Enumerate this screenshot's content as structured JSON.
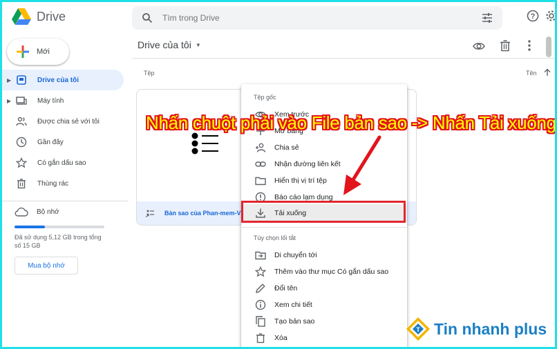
{
  "app": {
    "name": "Drive"
  },
  "search": {
    "placeholder": "Tìm trong Drive"
  },
  "sidebar": {
    "new_label": "Mới",
    "items": [
      {
        "label": "Drive của tôi",
        "icon": "drive-icon",
        "active": true
      },
      {
        "label": "Máy tính",
        "icon": "computer-icon"
      },
      {
        "label": "Được chia sẻ với tôi",
        "icon": "people-icon"
      },
      {
        "label": "Gần đây",
        "icon": "clock-icon"
      },
      {
        "label": "Có gắn dấu sao",
        "icon": "star-icon"
      },
      {
        "label": "Thùng rác",
        "icon": "trash-icon"
      }
    ],
    "storage": {
      "label": "Bộ nhớ",
      "usage_text": "Đã sử dụng 5,12 GB trong tổng số 15 GB",
      "used_fraction": 0.34,
      "buy_label": "Mua bộ nhớ"
    }
  },
  "main": {
    "title": "Drive của tôi",
    "files_label": "Tệp",
    "sort_label": "Tên",
    "file": {
      "name": "Bản sao của Phan-mem-V"
    }
  },
  "context_menu": {
    "section1": "Tệp gốc",
    "items1": [
      {
        "label": "Xem trước",
        "icon": "eye-icon"
      },
      {
        "label": "Mở bằng",
        "icon": "open-with-icon"
      },
      {
        "label": "Chia sẻ",
        "icon": "person-add-icon"
      },
      {
        "label": "Nhận đường liên kết",
        "icon": "link-icon"
      },
      {
        "label": "Hiển thị vị trí tệp",
        "icon": "folder-icon"
      },
      {
        "label": "Báo cáo lạm dụng",
        "icon": "report-icon"
      },
      {
        "label": "Tải xuống",
        "icon": "download-icon",
        "highlighted": true
      }
    ],
    "section2": "Tùy chọn lối tắt",
    "items2": [
      {
        "label": "Di chuyển tới",
        "icon": "move-icon"
      },
      {
        "label": "Thêm vào thư mục Có gắn dấu sao",
        "icon": "star-outline-icon"
      },
      {
        "label": "Đổi tên",
        "icon": "pencil-icon"
      },
      {
        "label": "Xem chi tiết",
        "icon": "info-icon"
      },
      {
        "label": "Tạo bản sao",
        "icon": "copy-icon"
      },
      {
        "label": "Xóa",
        "icon": "trash-icon"
      }
    ]
  },
  "annotation": {
    "text": "Nhấn chuột phải vào File bản sao -> Nhấn Tải xuống",
    "color": "#ffff00",
    "outline": "#e2141c"
  },
  "watermark": {
    "text": "Tin nhanh plus"
  },
  "colors": {
    "accent": "#1a73e8",
    "frame": "#1ee0e6",
    "highlight_box": "#e1262d"
  }
}
